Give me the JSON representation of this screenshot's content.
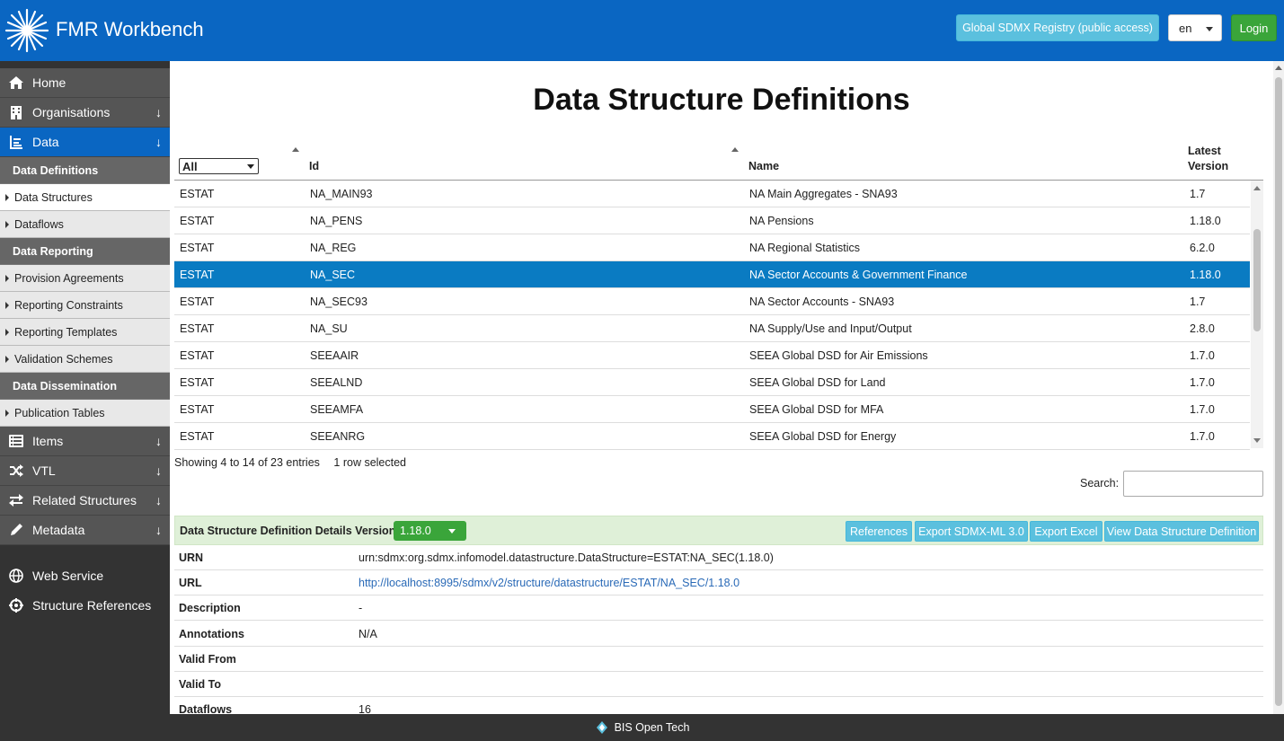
{
  "header": {
    "app_title": "FMR Workbench",
    "registry_button": "Global SDMX Registry (public access)",
    "language": "en",
    "login_button": "Login"
  },
  "sidebar": {
    "main_items": [
      {
        "label": "Home",
        "icon": "home-icon"
      },
      {
        "label": "Organisations",
        "icon": "building-icon"
      },
      {
        "label": "Data",
        "icon": "chart-icon"
      }
    ],
    "sections": {
      "definitions": "Data Definitions",
      "reporting": "Data Reporting",
      "dissemination": "Data Dissemination"
    },
    "sub_items": {
      "data_structures": "Data Structures",
      "dataflows": "Dataflows",
      "provision_agreements": "Provision Agreements",
      "reporting_constraints": "Reporting Constraints",
      "reporting_templates": "Reporting Templates",
      "validation_schemes": "Validation Schemes",
      "publication_tables": "Publication Tables"
    },
    "lower_items": [
      {
        "label": "Items",
        "icon": "list-icon"
      },
      {
        "label": "VTL",
        "icon": "shuffle-icon"
      },
      {
        "label": "Related Structures",
        "icon": "swap-icon"
      },
      {
        "label": "Metadata",
        "icon": "pencil-icon"
      }
    ],
    "bottom_items": [
      {
        "label": "Web Service",
        "icon": "globe-icon"
      },
      {
        "label": "Structure References",
        "icon": "crosshair-icon"
      }
    ]
  },
  "main": {
    "title": "Data Structure Definitions",
    "filter_value": "All",
    "columns": {
      "id": "Id",
      "name": "Name",
      "version_line1": "Latest",
      "version_line2": "Version"
    },
    "rows": [
      {
        "agency": "ESTAT",
        "id": "NA_MAIN93",
        "name": "NA Main Aggregates - SNA93",
        "version": "1.7"
      },
      {
        "agency": "ESTAT",
        "id": "NA_PENS",
        "name": "NA Pensions",
        "version": "1.18.0"
      },
      {
        "agency": "ESTAT",
        "id": "NA_REG",
        "name": "NA Regional Statistics",
        "version": "6.2.0"
      },
      {
        "agency": "ESTAT",
        "id": "NA_SEC",
        "name": "NA Sector Accounts & Government Finance",
        "version": "1.18.0"
      },
      {
        "agency": "ESTAT",
        "id": "NA_SEC93",
        "name": "NA Sector Accounts - SNA93",
        "version": "1.7"
      },
      {
        "agency": "ESTAT",
        "id": "NA_SU",
        "name": "NA Supply/Use and Input/Output",
        "version": "2.8.0"
      },
      {
        "agency": "ESTAT",
        "id": "SEEAAIR",
        "name": "SEEA Global DSD for Air Emissions",
        "version": "1.7.0"
      },
      {
        "agency": "ESTAT",
        "id": "SEEALND",
        "name": "SEEA Global DSD for Land",
        "version": "1.7.0"
      },
      {
        "agency": "ESTAT",
        "id": "SEEAMFA",
        "name": "SEEA Global DSD for MFA",
        "version": "1.7.0"
      },
      {
        "agency": "ESTAT",
        "id": "SEEANRG",
        "name": "SEEA Global DSD for Energy",
        "version": "1.7.0"
      }
    ],
    "entries_info": "Showing 4 to 14 of 23 entries",
    "selection_info": "1 row selected",
    "search_label": "Search:"
  },
  "details": {
    "title": "Data Structure Definition Details Version:",
    "version": "1.18.0",
    "buttons": {
      "references": "References",
      "export_sdmx": "Export SDMX-ML 3.0",
      "export_excel": "Export Excel",
      "view": "View Data Structure Definition"
    },
    "fields": [
      {
        "label": "URN",
        "value": "urn:sdmx:org.sdmx.infomodel.datastructure.DataStructure=ESTAT:NA_SEC(1.18.0)"
      },
      {
        "label": "URL",
        "value": "http://localhost:8995/sdmx/v2/structure/datastructure/ESTAT/NA_SEC/1.18.0"
      },
      {
        "label": "Description",
        "value": "-"
      },
      {
        "label": "Annotations",
        "value": "N/A"
      },
      {
        "label": "Valid From",
        "value": ""
      },
      {
        "label": "Valid To",
        "value": ""
      },
      {
        "label": "Dataflows",
        "value": "16"
      }
    ]
  },
  "footer": {
    "text": "BIS Open Tech"
  },
  "colors": {
    "brand_blue": "#0a66c2",
    "info_button": "#5bc0de",
    "success_green": "#3aa53a",
    "selected_row": "#0a7bc2"
  }
}
